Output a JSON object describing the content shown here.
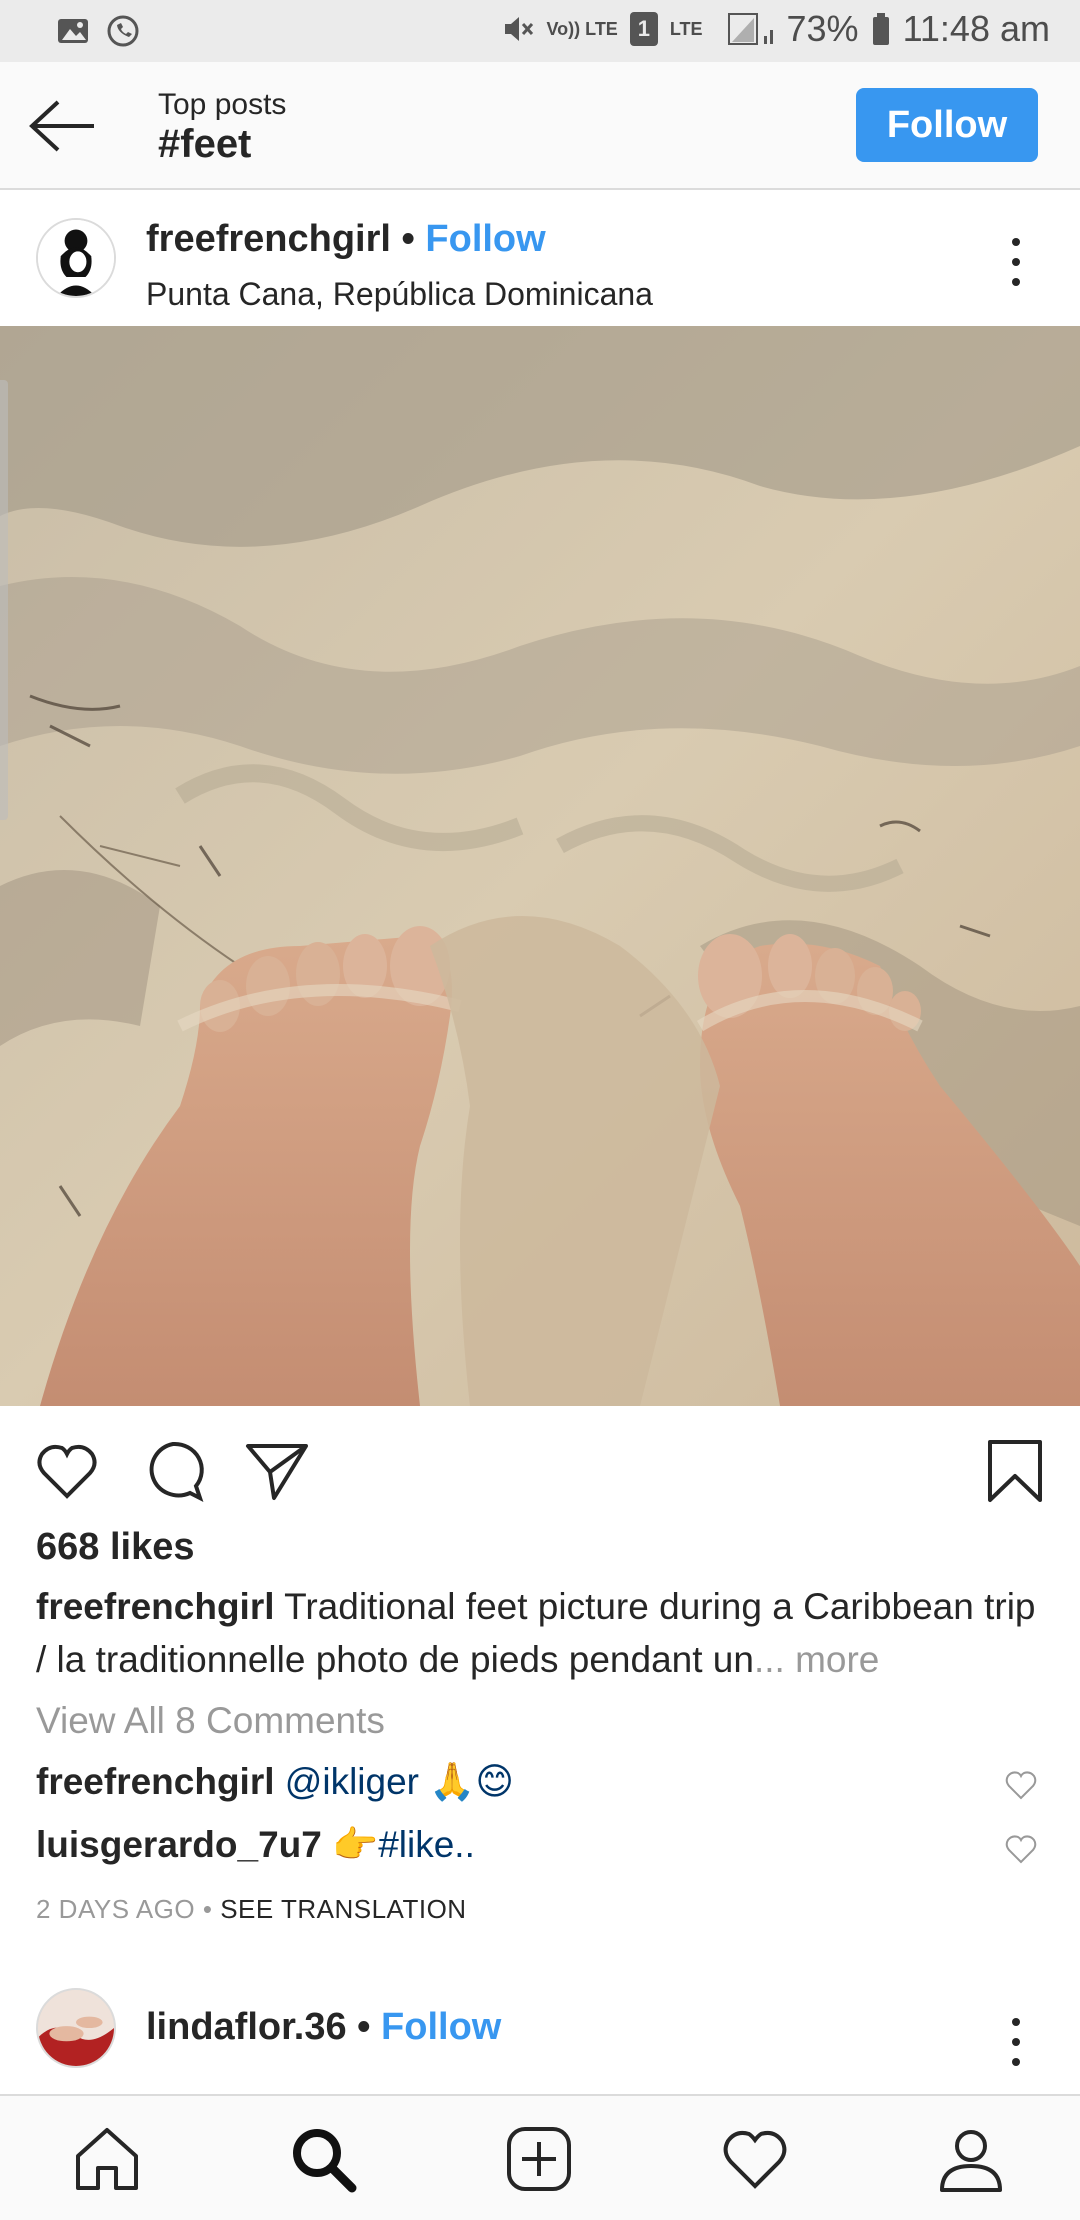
{
  "status_bar": {
    "battery": "73%",
    "time": "11:48 am",
    "lte_label": "LTE",
    "volte_label": "Vo)) LTE",
    "sim_label": "1",
    "icons": [
      "gallery-icon",
      "whatsapp-icon",
      "mute-icon",
      "signal-icon",
      "battery-icon"
    ]
  },
  "header": {
    "subtitle": "Top posts",
    "title": "#feet",
    "follow_label": "Follow"
  },
  "post": {
    "username": "freefrenchgirl",
    "separator": " • ",
    "follow_label": "Follow",
    "location": "Punta Cana, República Dominicana",
    "likes": "668 likes",
    "caption_user": "freefrenchgirl",
    "caption_text": " Traditional feet picture during a Caribbean trip / la traditionnelle photo de pieds pendant un",
    "caption_more": "... more",
    "view_comments": "View All 8 Comments",
    "comments": [
      {
        "user": "freefrenchgirl",
        "text": " @ikliger 🙏😊"
      },
      {
        "user": "luisgerardo_7u7",
        "text": " 👉#like.."
      }
    ],
    "time_ago": "2 DAYS AGO",
    "time_sep": " • ",
    "see_translation": "SEE TRANSLATION"
  },
  "next_post": {
    "username": "lindaflor.36",
    "separator": " • ",
    "follow_label": "Follow"
  },
  "bottom_nav": [
    "home-icon",
    "search-icon",
    "add-post-icon",
    "activity-heart-icon",
    "profile-icon"
  ],
  "colors": {
    "accent": "#3897f0",
    "text": "#262626",
    "muted": "#999999",
    "mention": "#003569"
  }
}
